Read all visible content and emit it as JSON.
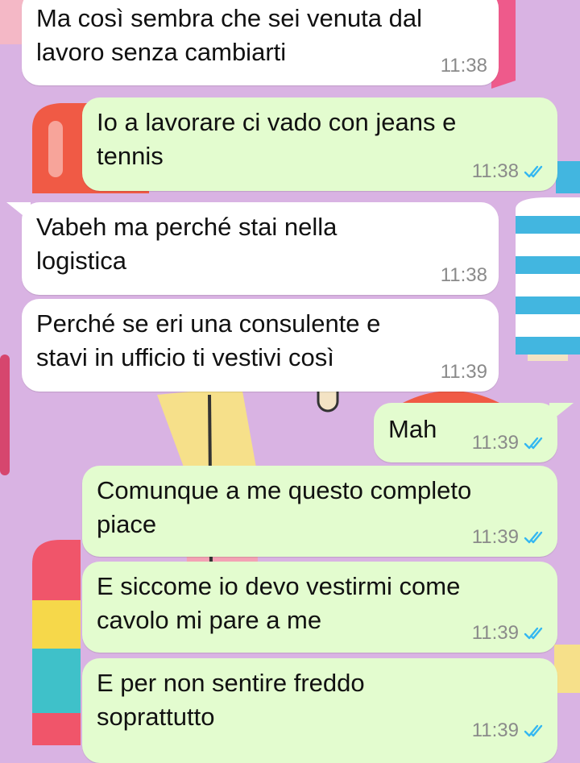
{
  "messages": [
    {
      "dir": "in",
      "text": "Ma così sembra che sei venuta dal\nlavoro senza cambiarti",
      "time": "11:38"
    },
    {
      "dir": "out",
      "text": "Io a lavorare ci vado con jeans e\ntennis",
      "time": "11:38",
      "status": "read-ticks-icon"
    },
    {
      "dir": "in",
      "text": "Vabeh ma perché stai nella\nlogistica",
      "time": "11:38"
    },
    {
      "dir": "in",
      "text": "Perché se eri una consulente e\nstavi in ufficio ti vestivi così",
      "time": "11:39"
    },
    {
      "dir": "out",
      "text": "Mah",
      "time": "11:39",
      "status": "read-ticks-icon"
    },
    {
      "dir": "out",
      "text": "Comunque a me questo completo\npiace",
      "time": "11:39",
      "status": "read-ticks-icon"
    },
    {
      "dir": "out",
      "text": "E siccome io devo vestirmi come\ncavolo mi pare a me",
      "time": "11:39",
      "status": "read-ticks-icon"
    },
    {
      "dir": "out",
      "text": "E per non sentire freddo\nsoprattutto",
      "time": "11:39",
      "status": "read-ticks-icon"
    }
  ],
  "colors": {
    "incoming_bubble": "#ffffff",
    "outgoing_bubble": "#e3fccf",
    "wallpaper": "#d9b3e3",
    "read_ticks": "#34b7f1",
    "timestamp": "#8a8a8a"
  },
  "wallpaper_theme": "popsicle-pattern"
}
